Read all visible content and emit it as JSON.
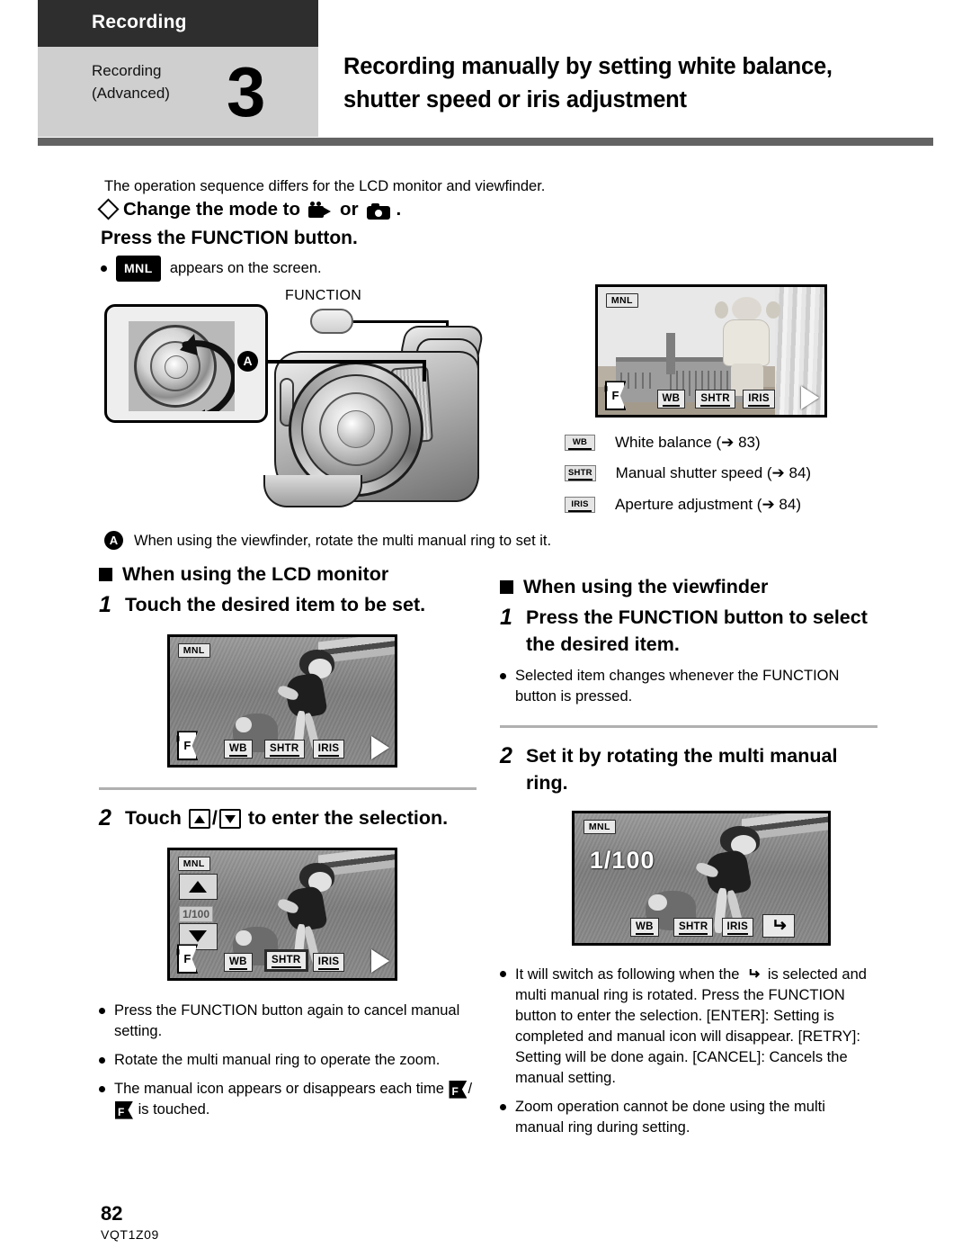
{
  "header": {
    "section_tab": "Recording",
    "chapter_line1": "Recording",
    "chapter_line2": "(Advanced)",
    "chapter_number": "3",
    "title": "Recording manually by setting white balance, shutter speed or iris adjustment"
  },
  "intro": {
    "lead": "The operation sequence differs for the LCD monitor and viewfinder.",
    "mode_prefix": "Change the mode to",
    "mode_or": "or",
    "mode_suffix": ".",
    "press_function": "Press the FUNCTION button.",
    "mnl_tag": "MNL",
    "mnl_note": "appears on the screen."
  },
  "figure": {
    "function_label": "FUNCTION",
    "callout_a": "A",
    "callout_a_note": "When using the viewfinder, rotate the multi manual ring to set it."
  },
  "lcd_top": {
    "mnl": "MNL",
    "f_icon": "F",
    "buttons": [
      "WB",
      "SHTR",
      "IRIS"
    ]
  },
  "legend": [
    {
      "icon": "WB",
      "text": "White balance (➔ 83)"
    },
    {
      "icon": "SHTR",
      "text": "Manual shutter speed (➔ 84)"
    },
    {
      "icon": "IRIS",
      "text": "Aperture adjustment (➔ 84)"
    }
  ],
  "left_column": {
    "heading": "When using the LCD monitor",
    "step1_num": "1",
    "step1_text": "Touch the desired item to be set.",
    "screen1": {
      "mnl": "MNL",
      "f_icon": "F",
      "buttons": [
        "WB",
        "SHTR",
        "IRIS"
      ]
    },
    "step2_num": "2",
    "step2_text_before": "Touch",
    "step2_text_sep": "/",
    "step2_text_after": "to enter the selection.",
    "screen2": {
      "mnl": "MNL",
      "f_icon": "F",
      "shutter_value": "1/100",
      "buttons": [
        "WB",
        "SHTR",
        "IRIS"
      ],
      "selected_button": "SHTR"
    },
    "notes": [
      "Press the FUNCTION button again to cancel manual setting.",
      "Rotate the multi manual ring to operate the zoom.",
      "The manual icon appears or disappears each time"
    ],
    "note3_tail": "is touched."
  },
  "right_column": {
    "heading": "When using the viewfinder",
    "step1_num": "1",
    "step1_text": "Press the FUNCTION button to select the desired item.",
    "step1_note": "Selected item changes whenever the FUNCTION button is pressed.",
    "step2_num": "2",
    "step2_text": "Set it by rotating the multi manual ring.",
    "screen": {
      "mnl": "MNL",
      "shutter_value": "1/100",
      "buttons": [
        "WB",
        "SHTR",
        "IRIS"
      ],
      "return_icon": "return-arrow"
    },
    "notes": [
      {
        "before": "It will switch as following when the",
        "after": "is selected and multi manual ring is rotated. Press the FUNCTION button to enter the selection. [ENTER]: Setting is completed and manual icon will disappear. [RETRY]: Setting will be done again. [CANCEL]: Cancels the manual setting."
      },
      {
        "before": "Zoom operation cannot be done using the multi manual ring during setting.",
        "after": ""
      }
    ]
  },
  "footer": {
    "page_number": "82",
    "doc_code": "VQT1Z09"
  }
}
